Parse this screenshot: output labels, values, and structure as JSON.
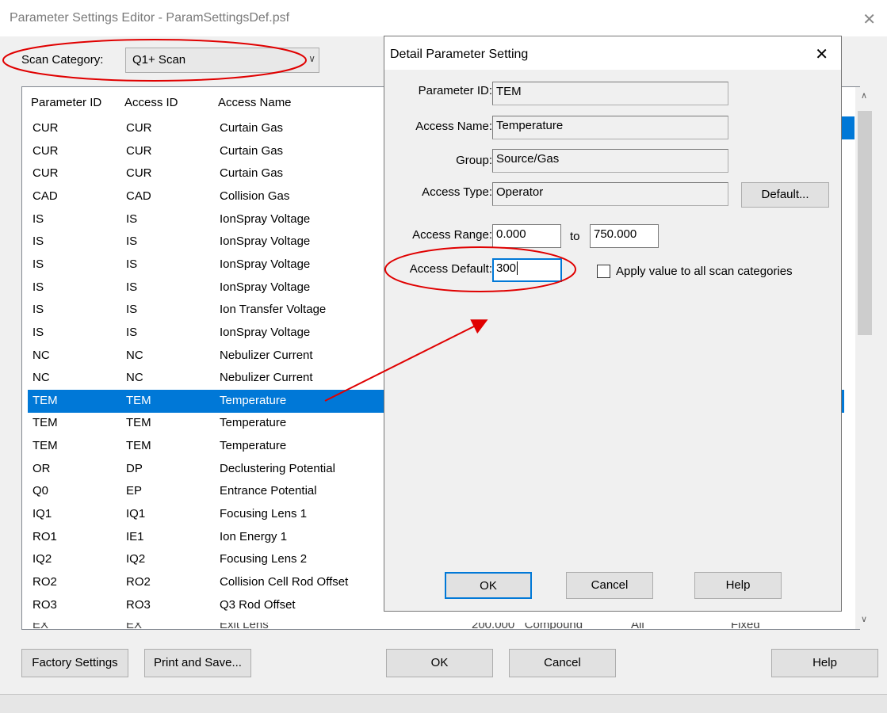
{
  "window": {
    "title": "Parameter Settings Editor - ParamSettingsDef.psf"
  },
  "scan_category": {
    "label": "Scan Category:",
    "value": "Q1+ Scan"
  },
  "table": {
    "columns": [
      "Parameter ID",
      "Access ID",
      "Access Name"
    ],
    "rows": [
      [
        "CUR",
        "CUR",
        "Curtain Gas"
      ],
      [
        "CUR",
        "CUR",
        "Curtain Gas"
      ],
      [
        "CUR",
        "CUR",
        "Curtain Gas"
      ],
      [
        "CAD",
        "CAD",
        "Collision Gas"
      ],
      [
        "IS",
        "IS",
        "IonSpray Voltage"
      ],
      [
        "IS",
        "IS",
        "IonSpray Voltage"
      ],
      [
        "IS",
        "IS",
        "IonSpray Voltage"
      ],
      [
        "IS",
        "IS",
        "IonSpray Voltage"
      ],
      [
        "IS",
        "IS",
        "Ion Transfer Voltage"
      ],
      [
        "IS",
        "IS",
        "IonSpray Voltage"
      ],
      [
        "NC",
        "NC",
        "Nebulizer Current"
      ],
      [
        "NC",
        "NC",
        "Nebulizer Current"
      ],
      [
        "TEM",
        "TEM",
        "Temperature"
      ],
      [
        "TEM",
        "TEM",
        "Temperature"
      ],
      [
        "TEM",
        "TEM",
        "Temperature"
      ],
      [
        "OR",
        "DP",
        "Declustering Potential"
      ],
      [
        "Q0",
        "EP",
        "Entrance Potential"
      ],
      [
        "IQ1",
        "IQ1",
        "Focusing Lens 1"
      ],
      [
        "RO1",
        "IE1",
        "Ion Energy 1"
      ],
      [
        "IQ2",
        "IQ2",
        "Focusing Lens 2"
      ],
      [
        "RO2",
        "RO2",
        "Collision Cell Rod Offset"
      ],
      [
        "RO3",
        "RO3",
        "Q3 Rod Offset"
      ]
    ],
    "selected_row": 12
  },
  "buttons": {
    "factory": "Factory Settings",
    "print_save": "Print and Save...",
    "ok": "OK",
    "cancel": "Cancel",
    "help": "Help"
  },
  "dialog": {
    "title": "Detail Parameter Setting",
    "parameter_id_label": "Parameter ID:",
    "parameter_id": "TEM",
    "access_name_label": "Access Name:",
    "access_name": "Temperature",
    "group_label": "Group:",
    "group": "Source/Gas",
    "access_type_label": "Access Type:",
    "access_type": "Operator",
    "default_btn": "Default...",
    "range_label": "Access Range:",
    "range_from": "0.000",
    "range_to_label": "to",
    "range_to": "750.000",
    "default_label": "Access Default:",
    "default_value": "300",
    "apply_all_label": "Apply value to all scan categories",
    "apply_all_checked": false,
    "ok": "OK",
    "cancel": "Cancel",
    "help": "Help"
  },
  "colors": {
    "selection": "#0078d7",
    "annotation": "#e00000"
  }
}
